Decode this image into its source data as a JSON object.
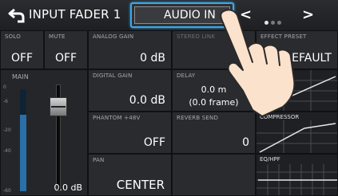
{
  "header": {
    "title": "INPUT FADER 1",
    "audio_in_label": "AUDIO IN",
    "prev_symbol": "<",
    "next_symbol": ">",
    "page_dots": 3,
    "active_dot": 0
  },
  "colors": {
    "accent": "#39a9e8",
    "meter": "#2a6fa8",
    "background": "#1a1b1e"
  },
  "icons": {
    "back": "back-arrow-icon",
    "hand": "pointing-hand-icon"
  },
  "solo": {
    "label": "SOLO",
    "value": "OFF"
  },
  "mute": {
    "label": "MUTE",
    "value": "OFF"
  },
  "analog_gain": {
    "label": "ANALOG GAIN",
    "value": "0 dB"
  },
  "stereo_link": {
    "label": "STEREO LINK"
  },
  "effect_preset": {
    "label": "EFFECT PRESET",
    "value": "DEFAULT"
  },
  "main": {
    "label": "MAIN",
    "value": "0.0 dB",
    "ticks": [
      "0",
      "-6",
      "-20",
      "-40",
      "-60"
    ],
    "meter_level": 0.75,
    "fader_level": 0.85
  },
  "digital_gain": {
    "label": "DIGITAL GAIN",
    "value": "0.0 dB"
  },
  "delay": {
    "label": "DELAY",
    "value": "0.0 m",
    "sub": "(0.0 frame)"
  },
  "phantom": {
    "label": "PHANTOM +48V",
    "value": "OFF"
  },
  "reverb_send": {
    "label": "REVERB SEND",
    "value": "0"
  },
  "pan": {
    "label": "PAN",
    "value": "CENTER"
  },
  "compressor": {
    "label": "COMPRESSOR"
  },
  "eq_hpf": {
    "label": "EQ/HPF"
  }
}
